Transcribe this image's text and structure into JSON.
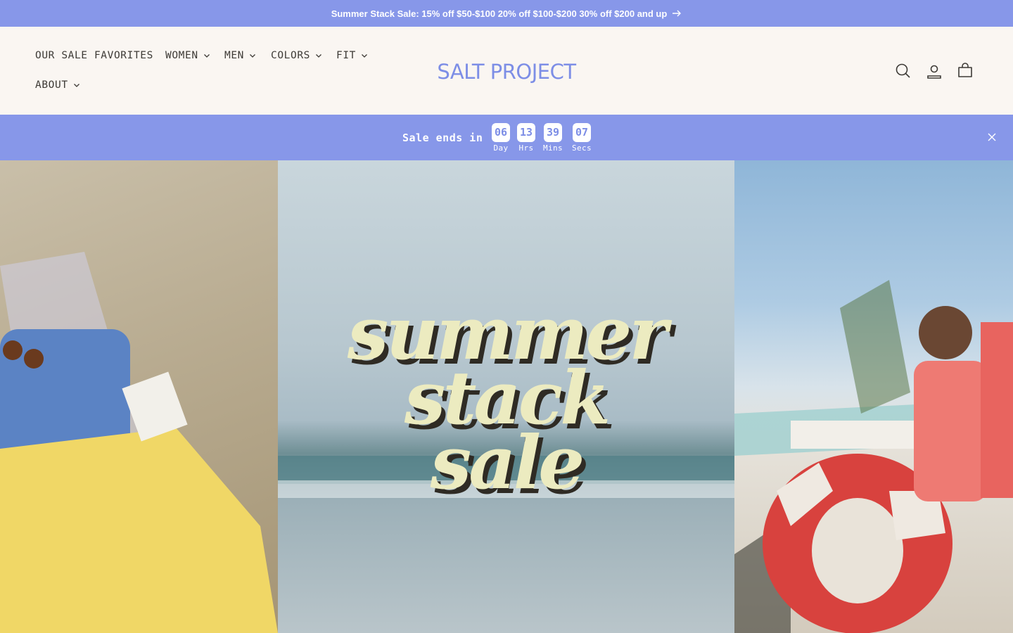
{
  "announcement": {
    "text": "Summer Stack Sale: 15% off $50-$100 20% off $100-$200 30% off $200 and up",
    "arrow_icon": "arrow-right-icon"
  },
  "header": {
    "logo": "SALT PROJECT",
    "nav": [
      {
        "label": "OUR SALE FAVORITES",
        "has_dropdown": false
      },
      {
        "label": "WOMEN",
        "has_dropdown": true
      },
      {
        "label": "MEN",
        "has_dropdown": true
      },
      {
        "label": "COLORS",
        "has_dropdown": true
      },
      {
        "label": "FIT",
        "has_dropdown": true
      },
      {
        "label": "ABOUT",
        "has_dropdown": true
      }
    ],
    "icons": [
      "search-icon",
      "account-icon",
      "cart-icon"
    ]
  },
  "countdown": {
    "label": "Sale ends in",
    "units": [
      {
        "value": "06",
        "caption": "Day"
      },
      {
        "value": "13",
        "caption": "Hrs"
      },
      {
        "value": "39",
        "caption": "Mins"
      },
      {
        "value": "07",
        "caption": "Secs"
      }
    ],
    "close_icon": "close-icon"
  },
  "hero": {
    "title_lines": [
      "summer",
      "stack",
      "sale"
    ]
  },
  "colors": {
    "accent": "#8797e9",
    "logo": "#7d8ee6",
    "background": "#faf6f2",
    "hero_title": "#ecebc0"
  }
}
